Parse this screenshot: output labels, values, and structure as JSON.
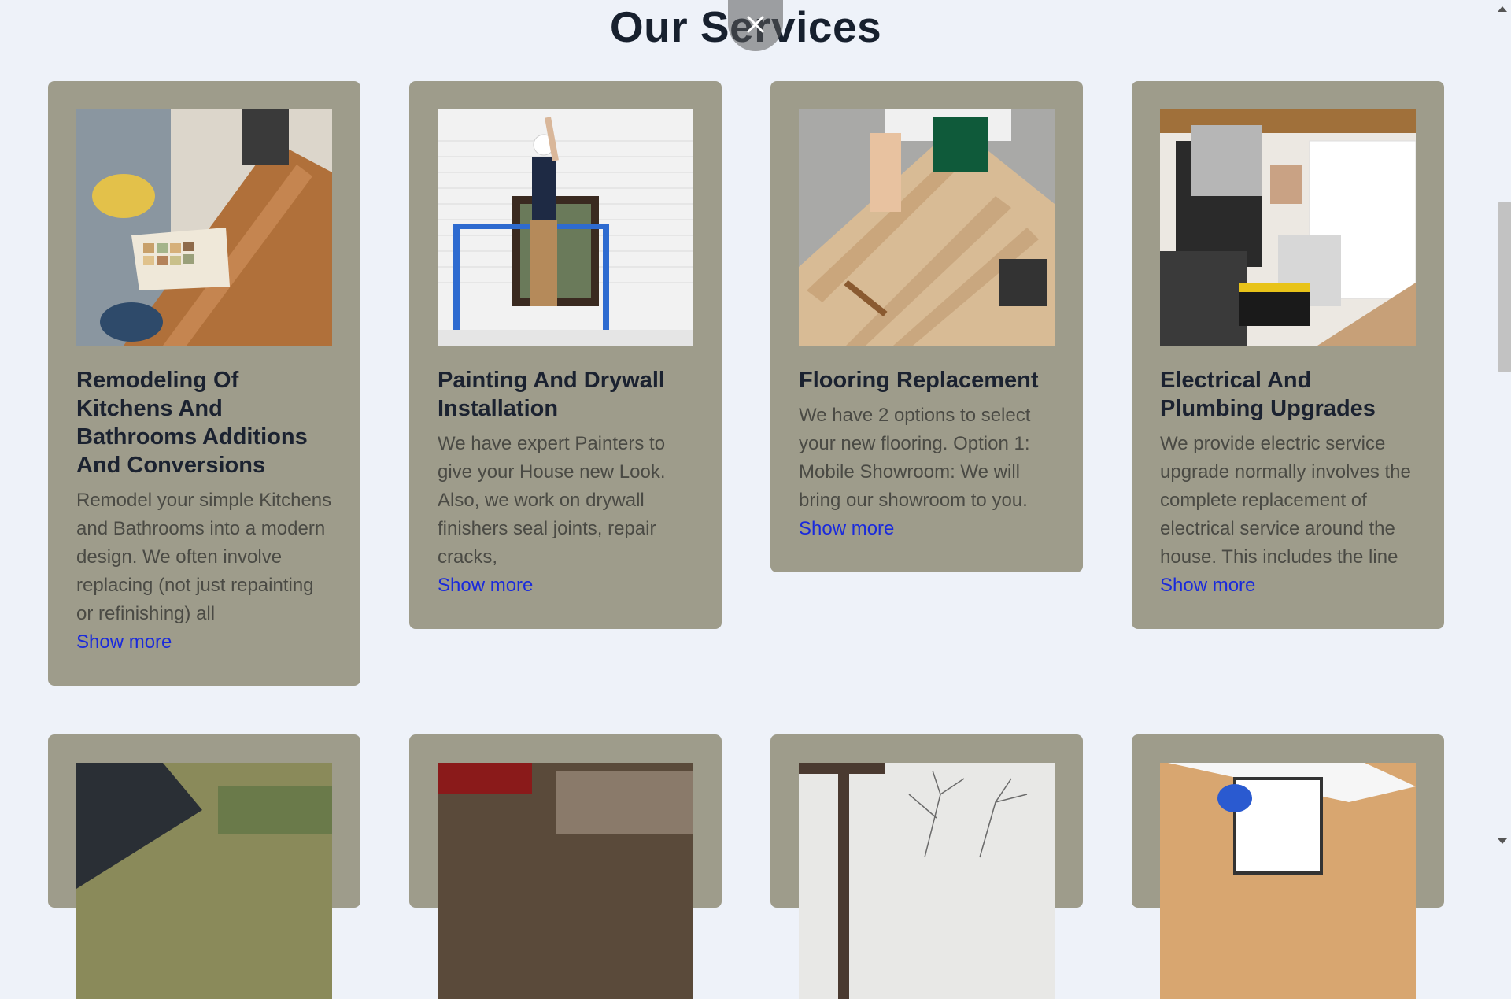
{
  "section": {
    "title": "Our Services"
  },
  "services": [
    {
      "title": "Remodeling Of Kitchens And Bathrooms Additions And Conversions",
      "description": "Remodel your simple Kitchens and Bathrooms into a modern design. We often involve replacing (not just repainting or refinishing) all",
      "link": "Show more",
      "image": "kitchen-remodel-photo"
    },
    {
      "title": "Painting And Drywall Installation",
      "description": "We have expert Painters to give your House new Look. Also, we work on drywall finishers seal joints, repair cracks,",
      "link": "Show more",
      "image": "painter-photo"
    },
    {
      "title": "Flooring Replacement",
      "description": "We have 2 options to select your new flooring. Option 1: Mobile Showroom: We will bring our showroom to you.",
      "link": "Show more",
      "image": "flooring-photo"
    },
    {
      "title": "Electrical And Plumbing Upgrades",
      "description": "We provide electric service upgrade normally involves the complete replacement of electrical service around the house. This includes the line",
      "link": "Show more",
      "image": "plumbing-photo"
    }
  ],
  "second_row_images": [
    "roofing-photo",
    "carpentry-photo",
    "landscaping-photo",
    "inspection-photo"
  ],
  "colors": {
    "background": "#eef2f9",
    "card": "#9e9c8b",
    "title": "#17202e",
    "link": "#1a2adb"
  }
}
